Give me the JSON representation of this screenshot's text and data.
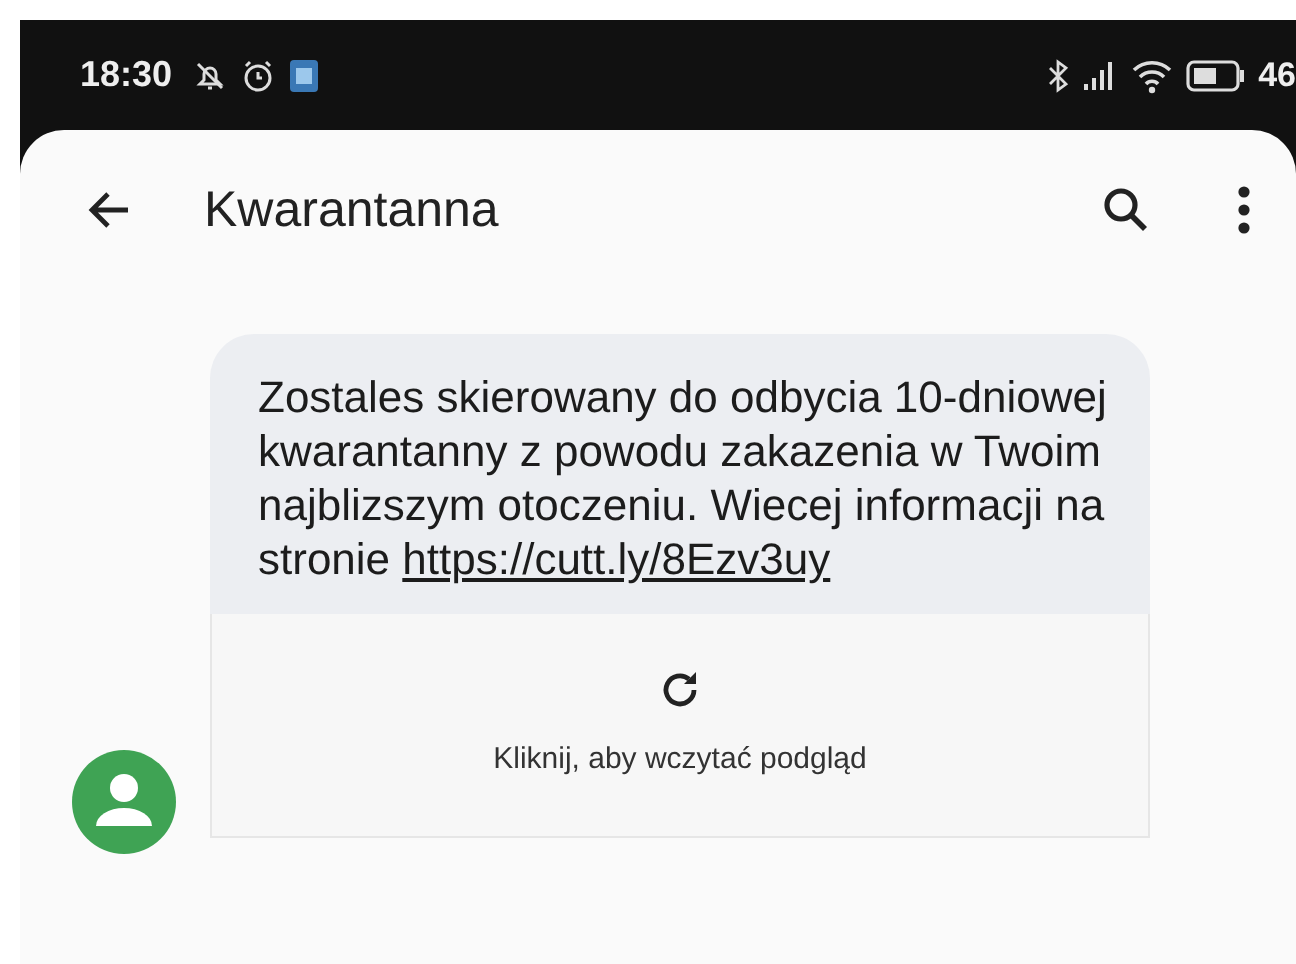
{
  "status_bar": {
    "time": "18:30",
    "battery": "46"
  },
  "toolbar": {
    "title": "Kwarantanna"
  },
  "message": {
    "text": "Zostales skierowany do odbycia 10-dniowej kwarantanny z powodu zakazenia w Twoim najblizszym otoczeniu. Wiecej informacji na stronie",
    "link": "https://cutt.ly/8Ezv3uy"
  },
  "preview": {
    "label": "Kliknij, aby wczytać podgląd"
  }
}
